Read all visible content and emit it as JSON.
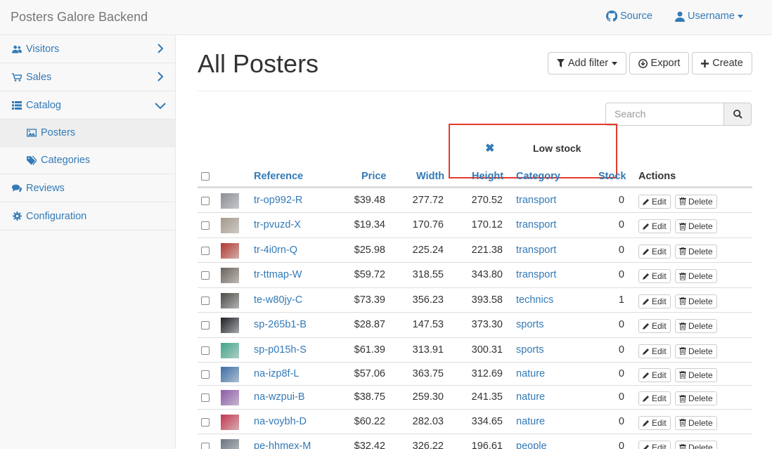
{
  "navbar": {
    "brand": "Posters Galore Backend",
    "source_label": "Source",
    "user_label": "Username"
  },
  "sidebar": {
    "items": [
      {
        "label": "Visitors"
      },
      {
        "label": "Sales"
      },
      {
        "label": "Catalog"
      },
      {
        "label": "Posters"
      },
      {
        "label": "Categories"
      },
      {
        "label": "Reviews"
      },
      {
        "label": "Configuration"
      }
    ]
  },
  "main": {
    "title": "All Posters",
    "add_filter_label": "Add filter",
    "export_label": "Export",
    "create_label": "Create",
    "search_placeholder": "Search",
    "active_filter_label": "Low stock"
  },
  "table": {
    "columns": [
      "Reference",
      "Price",
      "Width",
      "Height",
      "Category",
      "Stock",
      "Actions"
    ],
    "edit_label": "Edit",
    "delete_label": "Delete",
    "rows": [
      {
        "reference": "tr-op992-R",
        "price": "$39.48",
        "width": "277.72",
        "height": "270.52",
        "category": "transport",
        "stock": "0",
        "thumb_color": "#8a8f96"
      },
      {
        "reference": "tr-pvuzd-X",
        "price": "$19.34",
        "width": "170.76",
        "height": "170.12",
        "category": "transport",
        "stock": "0",
        "thumb_color": "#a59a8c"
      },
      {
        "reference": "tr-4i0rn-Q",
        "price": "$25.98",
        "width": "225.24",
        "height": "221.38",
        "category": "transport",
        "stock": "0",
        "thumb_color": "#b3362f"
      },
      {
        "reference": "tr-ttmap-W",
        "price": "$59.72",
        "width": "318.55",
        "height": "343.80",
        "category": "transport",
        "stock": "0",
        "thumb_color": "#6b625a"
      },
      {
        "reference": "te-w80jy-C",
        "price": "$73.39",
        "width": "356.23",
        "height": "393.58",
        "category": "technics",
        "stock": "1",
        "thumb_color": "#4a4c47"
      },
      {
        "reference": "sp-265b1-B",
        "price": "$28.87",
        "width": "147.53",
        "height": "373.30",
        "category": "sports",
        "stock": "0",
        "thumb_color": "#1c1f24"
      },
      {
        "reference": "sp-p015h-S",
        "price": "$61.39",
        "width": "313.91",
        "height": "300.31",
        "category": "sports",
        "stock": "0",
        "thumb_color": "#3fa58a"
      },
      {
        "reference": "na-izp8f-L",
        "price": "$57.06",
        "width": "363.75",
        "height": "312.69",
        "category": "nature",
        "stock": "0",
        "thumb_color": "#3b6ea8"
      },
      {
        "reference": "na-wzpui-B",
        "price": "$38.75",
        "width": "259.30",
        "height": "241.35",
        "category": "nature",
        "stock": "0",
        "thumb_color": "#8c5aa8"
      },
      {
        "reference": "na-voybh-D",
        "price": "$60.22",
        "width": "282.03",
        "height": "334.65",
        "category": "nature",
        "stock": "0",
        "thumb_color": "#c4354e"
      },
      {
        "reference": "pe-hhmex-M",
        "price": "$32.42",
        "width": "326.22",
        "height": "196.61",
        "category": "people",
        "stock": "0",
        "thumb_color": "#6a7480"
      }
    ]
  }
}
